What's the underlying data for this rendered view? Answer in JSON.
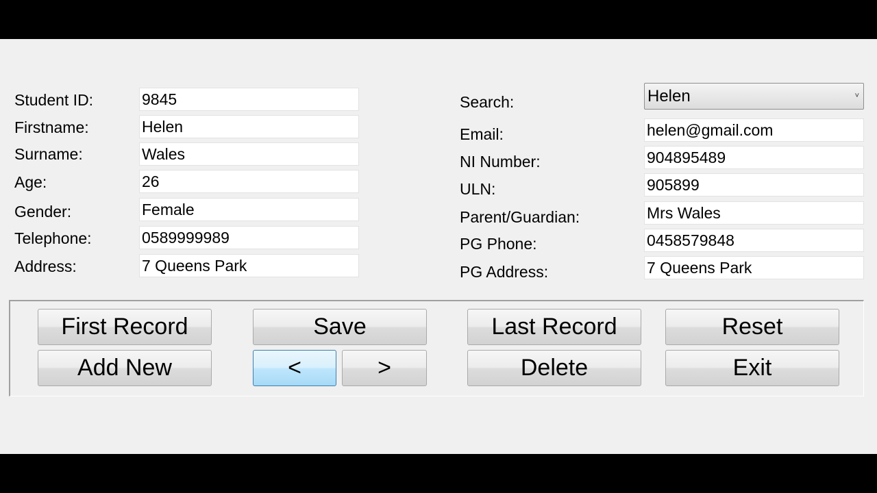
{
  "left": {
    "student_id": {
      "label": "Student ID:",
      "value": "9845"
    },
    "firstname": {
      "label": "Firstname:",
      "value": "Helen"
    },
    "surname": {
      "label": "Surname:",
      "value": "Wales"
    },
    "age": {
      "label": "Age:",
      "value": "26"
    },
    "gender": {
      "label": "Gender:",
      "value": "Female"
    },
    "telephone": {
      "label": "Telephone:",
      "value": "0589999989"
    },
    "address": {
      "label": "Address:",
      "value": "7 Queens Park"
    }
  },
  "right": {
    "search": {
      "label": "Search:",
      "value": "Helen",
      "arrow": "˅"
    },
    "email": {
      "label": "Email:",
      "value": "helen@gmail.com"
    },
    "ni_number": {
      "label": "NI Number:",
      "value": "904895489"
    },
    "uln": {
      "label": "ULN:",
      "value": "905899"
    },
    "parent_guardian": {
      "label": "Parent/Guardian:",
      "value": "Mrs Wales"
    },
    "pg_phone": {
      "label": "PG Phone:",
      "value": "0458579848"
    },
    "pg_address": {
      "label": "PG Address:",
      "value": "7 Queens Park"
    }
  },
  "buttons": {
    "first_record": "First Record",
    "add_new": "Add New",
    "save": "Save",
    "prev": "<",
    "next": ">",
    "last_record": "Last Record",
    "delete": "Delete",
    "reset": "Reset",
    "exit": "Exit"
  }
}
